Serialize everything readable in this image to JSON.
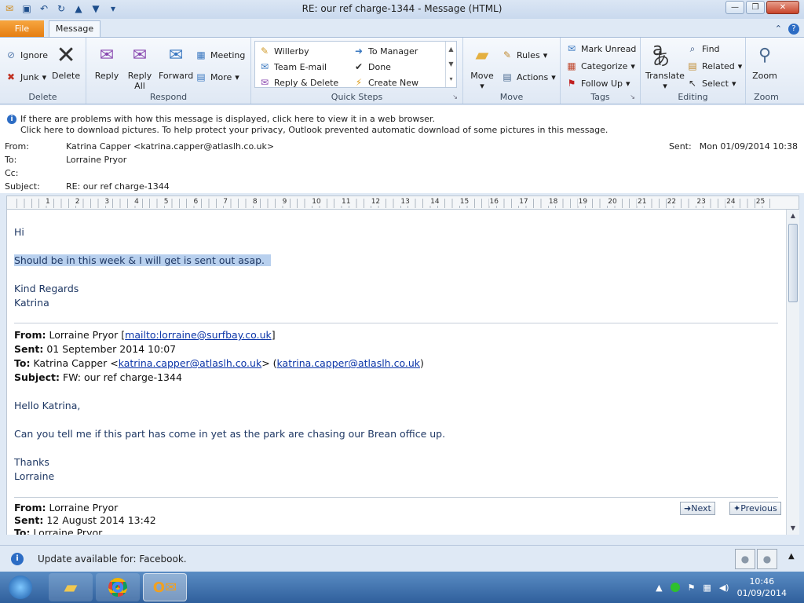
{
  "window": {
    "title": "RE: our ref charge-1344  -  Message (HTML)"
  },
  "tabs": {
    "file": "File",
    "message": "Message"
  },
  "ribbon": {
    "delete_group": {
      "label": "Delete",
      "ignore": "Ignore",
      "junk": "Junk",
      "delete": "Delete"
    },
    "respond_group": {
      "label": "Respond",
      "reply": "Reply",
      "reply_all_1": "Reply",
      "reply_all_2": "All",
      "forward": "Forward",
      "meeting": "Meeting",
      "more": "More"
    },
    "quick_steps": {
      "label": "Quick Steps",
      "items": [
        "Willerby",
        "To Manager",
        "Team E-mail",
        "Done",
        "Reply & Delete",
        "Create New"
      ]
    },
    "move_group": {
      "label": "Move",
      "move": "Move",
      "rules": "Rules",
      "actions": "Actions"
    },
    "tags_group": {
      "label": "Tags",
      "mark_unread": "Mark Unread",
      "categorize": "Categorize",
      "follow_up": "Follow Up"
    },
    "editing_group": {
      "label": "Editing",
      "translate": "Translate",
      "find": "Find",
      "related": "Related",
      "select": "Select"
    },
    "zoom_group": {
      "label": "Zoom",
      "zoom": "Zoom"
    }
  },
  "infobar": {
    "line1": "If there are problems with how this message is displayed, click here to view it in a web browser.",
    "line2": "Click here to download pictures. To help protect your privacy, Outlook prevented automatic download of some pictures in this message."
  },
  "header": {
    "from_label": "From:",
    "from": "Katrina Capper <katrina.capper@atlaslh.co.uk>",
    "to_label": "To:",
    "to": "Lorraine Pryor",
    "cc_label": "Cc:",
    "subject_label": "Subject:",
    "subject": "RE: our ref charge-1344",
    "sent_label": "Sent:",
    "sent": "Mon 01/09/2014 10:38"
  },
  "ruler": {
    "numbers": [
      "1",
      "2",
      "3",
      "4",
      "5",
      "6",
      "7",
      "8",
      "9",
      "10",
      "11",
      "12",
      "13",
      "14",
      "15",
      "16",
      "17",
      "18",
      "19",
      "20",
      "21",
      "22",
      "23",
      "24",
      "25"
    ]
  },
  "body": {
    "greeting": "Hi",
    "line1": "Should be in this week & I will get is sent out asap.",
    "regards": "Kind Regards",
    "name": "Katrina",
    "quoted1": {
      "from_label": "From:",
      "from_name": "Lorraine Pryor [",
      "from_link": "mailto:lorraine@surfbay.co.uk",
      "from_end": "]",
      "sent_label": "Sent:",
      "sent": "01 September 2014 10:07",
      "to_label": "To:",
      "to_name": "Katrina Capper <",
      "to_link1": "katrina.capper@atlaslh.co.uk",
      "to_mid": "> (",
      "to_link2": "katrina.capper@atlaslh.co.uk",
      "to_end": ")",
      "subject_label": "Subject:",
      "subject": "FW: our ref charge-1344",
      "greeting": "Hello Katrina,",
      "text": "Can you tell me if this part has come in yet as the park are chasing our Brean office up.",
      "thanks": "Thanks",
      "name": "Lorraine"
    },
    "quoted2": {
      "from_label": "From:",
      "from": "Lorraine Pryor",
      "sent_label": "Sent:",
      "sent": "12 August 2014 13:42",
      "to_label": "To:",
      "to": "Lorraine Pryor"
    },
    "next": "Next",
    "previous": "Previous"
  },
  "status": {
    "text": "Update available for: Facebook."
  },
  "taskbar": {
    "time": "10:46",
    "date": "01/09/2014"
  }
}
